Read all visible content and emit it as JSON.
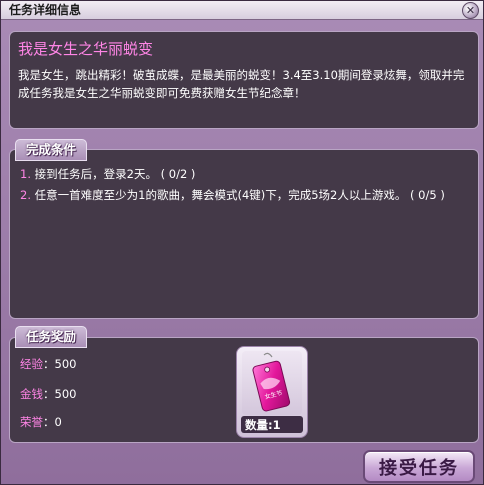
{
  "window": {
    "title": "任务详细信息"
  },
  "intro": {
    "title": "我是女生之华丽蜕变",
    "description": "我是女生，跳出精彩！破茧成蝶，是最美丽的蜕变！3.4至3.10期间登录炫舞，领取并完成任务我是女生之华丽蜕变即可免费获赠女生节纪念章！"
  },
  "conditions": {
    "heading": "完成条件",
    "items": [
      {
        "num": "1.",
        "text": " 接到任务后，登录2天。 ( 0/2 )"
      },
      {
        "num": "2.",
        "text": " 任意一首难度至少为1的歌曲，舞会模式(4键)下，完成5场2人以上游戏。 ( 0/5 )"
      }
    ]
  },
  "rewards": {
    "heading": "任务奖励",
    "exp_label": "经验",
    "exp_value": "：500",
    "gold_label": "金钱",
    "gold_value": "：500",
    "honor_label": "荣誉",
    "honor_value": "：0",
    "item": {
      "icon": "pink-badge-tag-icon",
      "tag_text": "女生节",
      "count_label": "数量:",
      "count_value": "1"
    }
  },
  "accept_button": {
    "label": "接受任务"
  },
  "colors": {
    "accent_pink": "#ff85e6",
    "panel_bg": "#443948"
  }
}
